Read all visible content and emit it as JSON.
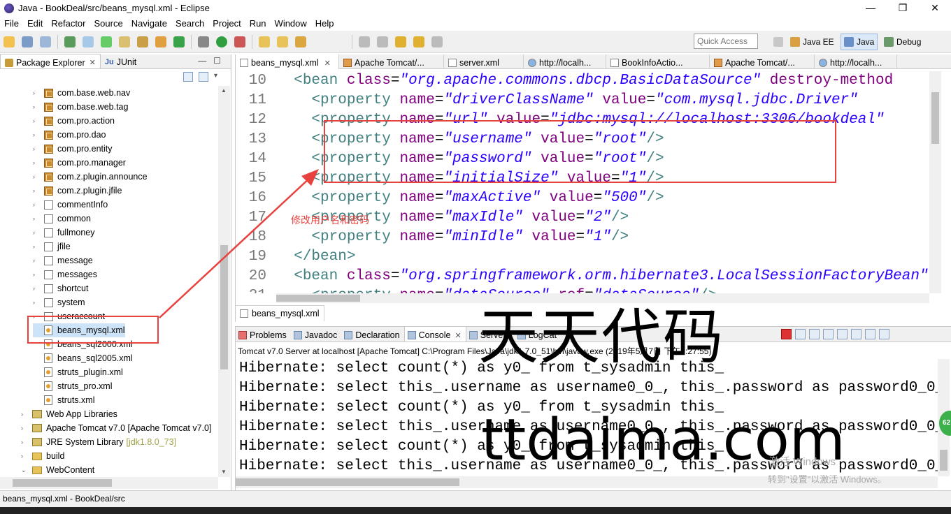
{
  "window": {
    "title": "Java - BookDeal/src/beans_mysql.xml - Eclipse",
    "controls": [
      "—",
      "❐",
      "✕"
    ]
  },
  "menu": [
    "File",
    "Edit",
    "Refactor",
    "Source",
    "Navigate",
    "Search",
    "Project",
    "Run",
    "Window",
    "Help"
  ],
  "toolbar": {
    "quick_access_placeholder": "Quick Access",
    "perspectives": [
      "Java EE",
      "Java",
      "Debug"
    ],
    "active_perspective": "Java"
  },
  "left_panel": {
    "tabs": [
      {
        "label": "Package Explorer",
        "active": true
      },
      {
        "label": "JUnit",
        "active": false
      }
    ],
    "tree": [
      {
        "label": "com.base.web.nav",
        "type": "package",
        "indent": 1
      },
      {
        "label": "com.base.web.tag",
        "type": "package",
        "indent": 1
      },
      {
        "label": "com.pro.action",
        "type": "package",
        "indent": 1
      },
      {
        "label": "com.pro.dao",
        "type": "package",
        "indent": 1
      },
      {
        "label": "com.pro.entity",
        "type": "package",
        "indent": 1
      },
      {
        "label": "com.pro.manager",
        "type": "package",
        "indent": 1
      },
      {
        "label": "com.z.plugin.announce",
        "type": "package",
        "indent": 1
      },
      {
        "label": "com.z.plugin.jfile",
        "type": "package",
        "indent": 1
      },
      {
        "label": "commentInfo",
        "type": "package-empty",
        "indent": 1
      },
      {
        "label": "common",
        "type": "package-empty",
        "indent": 1
      },
      {
        "label": "fullmoney",
        "type": "package-empty",
        "indent": 1
      },
      {
        "label": "jfile",
        "type": "package-empty",
        "indent": 1
      },
      {
        "label": "message",
        "type": "package-empty",
        "indent": 1
      },
      {
        "label": "messages",
        "type": "package-empty",
        "indent": 1
      },
      {
        "label": "shortcut",
        "type": "package-empty",
        "indent": 1
      },
      {
        "label": "system",
        "type": "package-empty",
        "indent": 1
      },
      {
        "label": "useraccount",
        "type": "package-empty",
        "indent": 1
      },
      {
        "label": "beans_mysql.xml",
        "type": "xml",
        "indent": 1,
        "selected": true
      },
      {
        "label": "beans_sql2000.xml",
        "type": "xml",
        "indent": 1
      },
      {
        "label": "beans_sql2005.xml",
        "type": "xml",
        "indent": 1
      },
      {
        "label": "struts_plugin.xml",
        "type": "xml",
        "indent": 1
      },
      {
        "label": "struts_pro.xml",
        "type": "xml",
        "indent": 1
      },
      {
        "label": "struts.xml",
        "type": "xml",
        "indent": 1
      },
      {
        "label": "Web App Libraries",
        "type": "library",
        "indent": 0
      },
      {
        "label": "Apache Tomcat v7.0 [Apache Tomcat v7.0]",
        "type": "library",
        "indent": 0
      },
      {
        "label": "JRE System Library",
        "suffix": "[jdk1.8.0_73]",
        "type": "library",
        "indent": 0
      },
      {
        "label": "build",
        "type": "folder",
        "indent": 0
      },
      {
        "label": "WebContent",
        "type": "folder",
        "indent": 0,
        "expanded": true
      }
    ]
  },
  "editor": {
    "tabs": [
      {
        "label": "beans_mysql.xml",
        "icon": "xml",
        "active": true,
        "closable": true
      },
      {
        "label": "Apache Tomcat/...",
        "icon": "cat"
      },
      {
        "label": "server.xml",
        "icon": "xml"
      },
      {
        "label": "http://localh...",
        "icon": "globe"
      },
      {
        "label": "BookInfoActio...",
        "icon": "java"
      },
      {
        "label": "Apache Tomcat/...",
        "icon": "cat"
      },
      {
        "label": "http://localh...",
        "icon": "globe"
      }
    ],
    "bottom_tab": "beans_mysql.xml",
    "lines": [
      {
        "n": "10",
        "indent": "  ",
        "parts": [
          [
            "tag",
            "<bean "
          ],
          [
            "attr",
            "class"
          ],
          [
            "pun",
            "="
          ],
          [
            "val",
            "\"org.apache.commons.dbcp.BasicDataSource\""
          ],
          [
            "pun",
            " "
          ],
          [
            "attr",
            "destroy-method"
          ]
        ]
      },
      {
        "n": "11",
        "indent": "    ",
        "parts": [
          [
            "tag",
            "<property "
          ],
          [
            "attr",
            "name"
          ],
          [
            "pun",
            "="
          ],
          [
            "val",
            "\"driverClassName\""
          ],
          [
            "pun",
            " "
          ],
          [
            "attr",
            "value"
          ],
          [
            "pun",
            "="
          ],
          [
            "val",
            "\"com.mysql.jdbc.Driver\""
          ]
        ]
      },
      {
        "n": "12",
        "indent": "    ",
        "parts": [
          [
            "tag",
            "<property "
          ],
          [
            "attr",
            "name"
          ],
          [
            "pun",
            "="
          ],
          [
            "val",
            "\"url\""
          ],
          [
            "pun",
            " "
          ],
          [
            "attr",
            "value"
          ],
          [
            "pun",
            "="
          ],
          [
            "val",
            "\"jdbc:mysql://localhost:3306/bookdeal\""
          ]
        ]
      },
      {
        "n": "13",
        "indent": "    ",
        "parts": [
          [
            "tag",
            "<property "
          ],
          [
            "attr",
            "name"
          ],
          [
            "pun",
            "="
          ],
          [
            "val",
            "\"username\""
          ],
          [
            "pun",
            " "
          ],
          [
            "attr",
            "value"
          ],
          [
            "pun",
            "="
          ],
          [
            "val",
            "\"root\""
          ],
          [
            "tag",
            "/>"
          ]
        ]
      },
      {
        "n": "14",
        "indent": "    ",
        "parts": [
          [
            "tag",
            "<property "
          ],
          [
            "attr",
            "name"
          ],
          [
            "pun",
            "="
          ],
          [
            "val",
            "\"password\""
          ],
          [
            "pun",
            " "
          ],
          [
            "attr",
            "value"
          ],
          [
            "pun",
            "="
          ],
          [
            "val",
            "\"root\""
          ],
          [
            "tag",
            "/>"
          ]
        ]
      },
      {
        "n": "15",
        "indent": "    ",
        "parts": [
          [
            "tag",
            "<property "
          ],
          [
            "attr",
            "name"
          ],
          [
            "pun",
            "="
          ],
          [
            "val",
            "\"initialSize\""
          ],
          [
            "pun",
            " "
          ],
          [
            "attr",
            "value"
          ],
          [
            "pun",
            "="
          ],
          [
            "val",
            "\"1\""
          ],
          [
            "tag",
            "/>"
          ]
        ]
      },
      {
        "n": "16",
        "indent": "    ",
        "parts": [
          [
            "tag",
            "<property "
          ],
          [
            "attr",
            "name"
          ],
          [
            "pun",
            "="
          ],
          [
            "val",
            "\"maxActive\""
          ],
          [
            "pun",
            " "
          ],
          [
            "attr",
            "value"
          ],
          [
            "pun",
            "="
          ],
          [
            "val",
            "\"500\""
          ],
          [
            "tag",
            "/>"
          ]
        ]
      },
      {
        "n": "17",
        "indent": "    ",
        "parts": [
          [
            "tag",
            "<property "
          ],
          [
            "attr",
            "name"
          ],
          [
            "pun",
            "="
          ],
          [
            "val",
            "\"maxIdle\""
          ],
          [
            "pun",
            " "
          ],
          [
            "attr",
            "value"
          ],
          [
            "pun",
            "="
          ],
          [
            "val",
            "\"2\""
          ],
          [
            "tag",
            "/>"
          ]
        ]
      },
      {
        "n": "18",
        "indent": "    ",
        "parts": [
          [
            "tag",
            "<property "
          ],
          [
            "attr",
            "name"
          ],
          [
            "pun",
            "="
          ],
          [
            "val",
            "\"minIdle\""
          ],
          [
            "pun",
            " "
          ],
          [
            "attr",
            "value"
          ],
          [
            "pun",
            "="
          ],
          [
            "val",
            "\"1\""
          ],
          [
            "tag",
            "/>"
          ]
        ]
      },
      {
        "n": "19",
        "indent": "  ",
        "parts": [
          [
            "tag",
            "</bean>"
          ]
        ]
      },
      {
        "n": "20",
        "indent": "  ",
        "parts": [
          [
            "tag",
            "<bean "
          ],
          [
            "attr",
            "class"
          ],
          [
            "pun",
            "="
          ],
          [
            "val",
            "\"org.springframework.orm.hibernate3.LocalSessionFactoryBean\""
          ]
        ]
      },
      {
        "n": "21",
        "indent": "    ",
        "parts": [
          [
            "tag",
            "<property "
          ],
          [
            "attr",
            "name"
          ],
          [
            "pun",
            "="
          ],
          [
            "val",
            "\"dataSource\""
          ],
          [
            "pun",
            " "
          ],
          [
            "attr",
            "ref"
          ],
          [
            "pun",
            "="
          ],
          [
            "val",
            "\"dataSource\""
          ],
          [
            "tag",
            "/>"
          ]
        ]
      }
    ]
  },
  "console": {
    "tabs": [
      {
        "label": "Problems",
        "icon": "err"
      },
      {
        "label": "Javadoc",
        "icon": "at"
      },
      {
        "label": "Declaration",
        "icon": "decl"
      },
      {
        "label": "Console",
        "icon": "console",
        "active": true,
        "closable": true
      },
      {
        "label": "Servers",
        "icon": "srv"
      },
      {
        "label": "LogCat",
        "icon": "log"
      }
    ],
    "status": "Tomcat v7.0 Server at localhost [Apache Tomcat] C:\\Program Files\\Java\\jdk1.7.0_51\\bin\\javaw.exe (2019年5月7日 下午2:27:55)",
    "lines": [
      "Hibernate: select count(*) as y0_ from t_sysadmin this_",
      "Hibernate: select this_.username as username0_0_, this_.password as password0_0_",
      "Hibernate: select count(*) as y0_ from t_sysadmin this_",
      "Hibernate: select this_.username as username0_0_, this_.password as password0_0_",
      "Hibernate: select count(*) as y0_ from t_sysadmin this_",
      "Hibernate: select this_.username as username0_0_, this_.password as password0_0_"
    ]
  },
  "status_bar": "beans_mysql.xml - BookDeal/src",
  "annotation": "修改用户名和密码",
  "watermark": {
    "cn": "天天代码",
    "url": "ttdaima.com"
  },
  "activation": {
    "line1": "激活 Windows",
    "line2": "转到\"设置\"以激活 Windows。"
  },
  "badge": "62",
  "colors": {
    "annotation_red": "#e8423f",
    "xml_tag": "#3f7f7f",
    "xml_attr": "#7f007f",
    "xml_value": "#2a00ff"
  }
}
